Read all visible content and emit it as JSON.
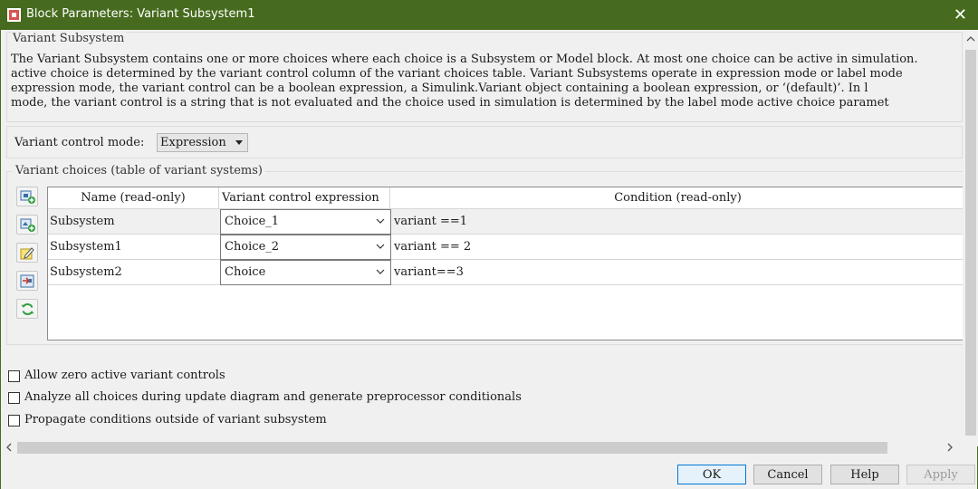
{
  "window": {
    "title": "Block Parameters: Variant Subsystem1",
    "close_glyph": "✕"
  },
  "description": {
    "group_title": "Variant Subsystem",
    "lines": [
      "The Variant Subsystem contains one or more choices where each choice is a Subsystem or Model block. At most one choice can be active in simulation.",
      "active choice is determined by the variant control column of the variant choices table. Variant Subsystems operate in expression mode or label mode",
      "expression mode, the variant control can be a boolean expression, a Simulink.Variant object containing a boolean expression, or  ‘(default)’. In l",
      "mode, the variant control is a string that is not evaluated and the choice used in simulation is determined by the label mode active choice paramet"
    ]
  },
  "mode": {
    "label": "Variant control mode:",
    "value": "Expression"
  },
  "choices": {
    "group_title": "Variant choices (table of variant systems)",
    "toolbar": [
      "add-choice-icon",
      "add-model-choice-icon",
      "edit-icon",
      "open-block-icon",
      "refresh-icon"
    ],
    "columns": [
      "Name (read-only)",
      "Variant control expression",
      "Condition (read-only)"
    ],
    "rows": [
      {
        "name": "Subsystem",
        "expression": "Choice_1",
        "condition": "variant ==1"
      },
      {
        "name": "Subsystem1",
        "expression": "Choice_2",
        "condition": "variant == 2"
      },
      {
        "name": "Subsystem2",
        "expression": "Choice",
        "condition": "variant==3"
      }
    ]
  },
  "options": [
    {
      "label": "Allow zero active variant controls",
      "checked": false
    },
    {
      "label": "Analyze all choices during update diagram and generate preprocessor conditionals",
      "checked": false
    },
    {
      "label": "Propagate conditions outside of variant subsystem",
      "checked": false
    }
  ],
  "buttons": {
    "ok": "OK",
    "cancel": "Cancel",
    "help": "Help",
    "apply": "Apply"
  },
  "colors": {
    "titlebar": "#466b1e",
    "ok_border": "#0078d7"
  }
}
